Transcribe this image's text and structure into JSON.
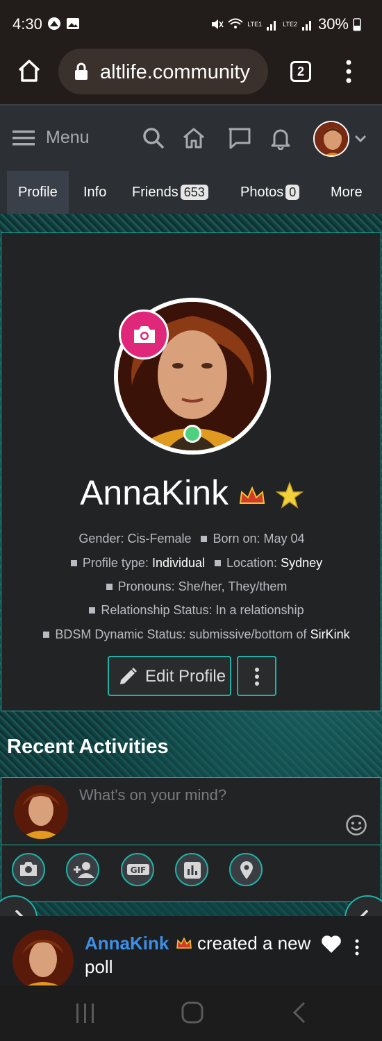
{
  "status_bar": {
    "time": "4:30",
    "battery": "30%",
    "lte1": "LTE1",
    "lte2": "LTE2"
  },
  "browser": {
    "url": "altlife.community",
    "tab_count": "2"
  },
  "navbar": {
    "menu_label": "Menu"
  },
  "tabs": [
    {
      "label": "Profile",
      "active": true
    },
    {
      "label": "Info"
    },
    {
      "label": "Friends",
      "badge": "653"
    },
    {
      "label": "Photos",
      "badge": "0"
    },
    {
      "label": "More"
    }
  ],
  "profile": {
    "username": "AnnaKink",
    "gender": "Gender: Cis-Female",
    "born": "Born on: May 04",
    "profile_type_label": "Profile type:",
    "profile_type_value": "Individual",
    "location_label": "Location:",
    "location_value": "Sydney",
    "pronouns": "Pronouns: She/her, They/them",
    "relationship": "Relationship Status: In a relationship",
    "bdsm_label": "BDSM Dynamic Status: submissive/bottom of",
    "bdsm_partner": "SirKink",
    "edit_label": "Edit Profile"
  },
  "recent": {
    "title": "Recent Activities",
    "placeholder": "What's on your mind?"
  },
  "activity": {
    "name": "AnnaKink",
    "text": "created a new",
    "text2": "poll"
  },
  "colors": {
    "accent": "#1fb3a8",
    "camera": "#e0287a",
    "online": "#4fd07f",
    "link": "#3d8fe8"
  }
}
